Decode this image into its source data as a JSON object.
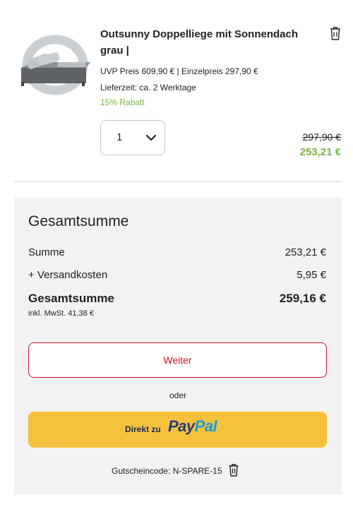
{
  "product": {
    "image_icon": "sun-lounger-image",
    "title": "Outsunny Doppelliege mit Sonnendach grau |",
    "uvp_line": "UVP Preis  609,90 € | Einzelpreis  297,90 €",
    "lieferzeit": "Lieferzeit: ca. 2 Werktage",
    "rabatt": "15% Rabatt",
    "quantity": "1",
    "price_old": "297,90 €",
    "price_new": "253,21 €",
    "delete_icon": "trash-icon"
  },
  "summary": {
    "title": "Gesamtsumme",
    "rows": [
      {
        "label": "Summe",
        "value": "253,21 €"
      },
      {
        "label": "+ Versandkosten",
        "value": "5,95 €"
      }
    ],
    "total_label": "Gesamtsumme",
    "total_value": "259,16 €",
    "vat_note": "inkl. MwSt. 41,38 €",
    "continue_label": "Weiter",
    "or_label": "oder",
    "paypal_prefix": "Direkt zu",
    "paypal_pay": "Pay",
    "paypal_pal": "Pal",
    "coupon_text": "Gutscheincode: N-SPARE-15"
  },
  "colors": {
    "discount_green": "#7ab343",
    "brand_red": "#c8102e",
    "paypal_yellow": "#f6c13d",
    "paypal_dark_blue": "#253b80",
    "paypal_light_blue": "#179bd7",
    "panel_bg": "#f2f2f2"
  }
}
